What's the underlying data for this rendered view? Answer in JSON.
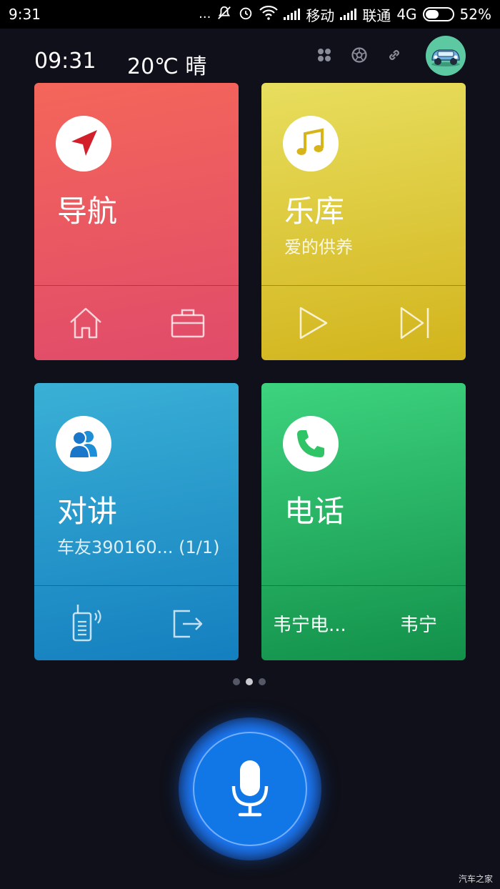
{
  "status_bar": {
    "time": "9:31",
    "dots": "...",
    "carrier1": "移动",
    "carrier2": "联通",
    "network": "4G",
    "battery_text": "52%",
    "battery_level": 0.52
  },
  "header": {
    "time": "09:31",
    "weather": "20℃ 晴"
  },
  "cards": {
    "navigation": {
      "title": "导航",
      "color_top": "#f4665a",
      "color_bottom": "#e04b6a"
    },
    "music": {
      "title": "乐库",
      "subtitle": "爱的供养",
      "color_top": "#e8de5e",
      "color_bottom": "#d2b41c"
    },
    "intercom": {
      "title": "对讲",
      "subtitle": "车友390160... (1/1)",
      "color_top": "#3ab0d6",
      "color_bottom": "#147fbf"
    },
    "phone": {
      "title": "电话",
      "contact1": "韦宁电...",
      "contact2": "韦宁",
      "color_top": "#3dd37e",
      "color_bottom": "#12904a"
    }
  },
  "pager": {
    "count": 3,
    "active_index": 1
  },
  "mic": {
    "color": "#1277e6"
  },
  "watermark": "汽车之家"
}
